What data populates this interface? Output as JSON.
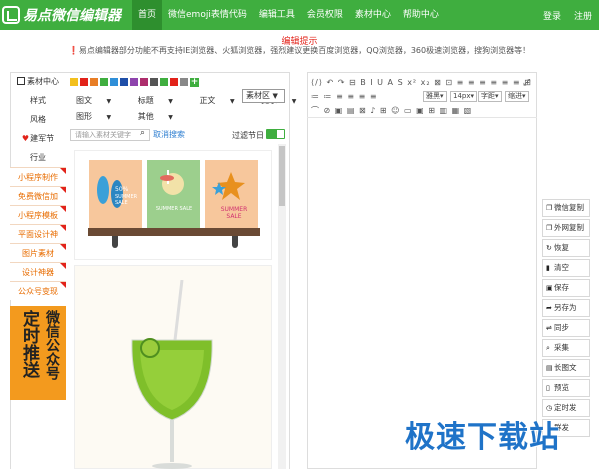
{
  "header": {
    "logo_text": "易点微信编辑器",
    "nav": [
      "首页",
      "微信emoji表情代码",
      "编辑工具",
      "会员权限",
      "素材中心",
      "帮助中心"
    ],
    "login": "登录",
    "register": "注册",
    "brand_color": "#3fae3f"
  },
  "notice": {
    "title": "编辑提示",
    "text": "❗易点编辑器部分功能不再支持IE浏览器、火狐浏览器，强烈建议更换百度浏览器，QQ浏览器，360极速浏览器，搜狗浏览器等！"
  },
  "sidebar": {
    "head": "素材中心",
    "plain": [
      "样式",
      "风格"
    ],
    "festival": "建军节",
    "industry": "行业",
    "tags": [
      "小程序制作",
      "免费微信加",
      "小程序模板",
      "平面设计神",
      "图片素材",
      "设计神器",
      "公众号变现"
    ],
    "promo_a": "微信公众号",
    "promo_b": "定时推送"
  },
  "material": {
    "colors": [
      "#f3c01e",
      "#e2231a",
      "#e87e26",
      "#3fae3f",
      "#2f8fd8",
      "#1f4fa8",
      "#8e44ad",
      "#ad2d6c",
      "#555555",
      "#3fae3f",
      "#e2231a",
      "#888888"
    ],
    "add_color": "+",
    "row1": [
      "图文",
      "标题",
      "正文",
      "提示"
    ],
    "row2": [
      "图形",
      "其他"
    ],
    "area_select": "素材区",
    "search_placeholder": "请输入素材关键字",
    "cancel_search": "取消搜索",
    "filter_label": "过滤节日",
    "filter_on": true,
    "poster_text": "SUMMER SALE",
    "poster_text2": "50%"
  },
  "editor": {
    "toolbar_row1": "⟨/⟩ ↶ ↷ ⊟ B I U A S x² x₂ ⊠ ⊡ ≡ ≡ ≡ ≡ ≡ ≡ ⊞",
    "toolbar_row2": "≔ ≔ ≡ ≡ ≡ ≡",
    "font_family": "雅黑",
    "font_size": "14px",
    "letter_spacing": "字距",
    "indent": "缩进",
    "toolbar_row3": "⌒ ⊘ ▣ ▤ ⊠ ♪ ⊞ ☺ ▭ ▣ ⊞ ▥ ▦ ▧"
  },
  "actions": [
    {
      "label": "微信复制",
      "icon": "copy-icon"
    },
    {
      "label": "外网复制",
      "icon": "copy-icon"
    },
    {
      "label": "恢复",
      "icon": "refresh-icon"
    },
    {
      "label": "清空",
      "icon": "trash-icon"
    },
    {
      "label": "保存",
      "icon": "save-icon"
    },
    {
      "label": "另存为",
      "icon": "save-as-icon"
    },
    {
      "label": "同步",
      "icon": "sync-icon"
    },
    {
      "label": "采集",
      "icon": "search-icon"
    },
    {
      "label": "长图文",
      "icon": "image-icon"
    },
    {
      "label": "预览",
      "icon": "phone-icon"
    },
    {
      "label": "定时发",
      "icon": "clock-icon"
    },
    {
      "label": "群发",
      "icon": "send-icon"
    }
  ],
  "watermark": "极速下载站"
}
